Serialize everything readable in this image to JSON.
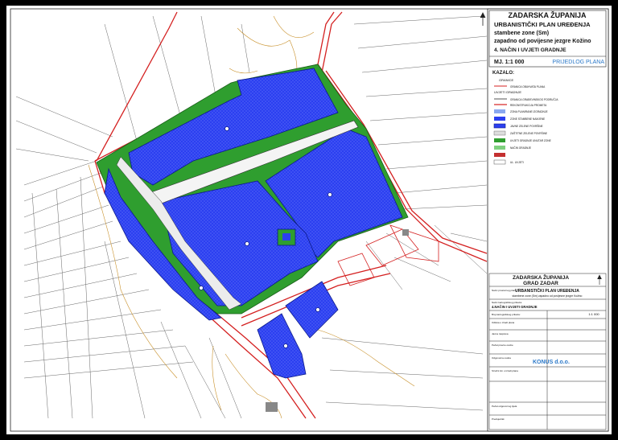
{
  "title_block": {
    "county": "ZADARSKA ŽUPANIJA",
    "plan_type": "URBANISTIČKI PLAN UREĐENJA",
    "line2": "stambene zone (Sm)",
    "line3": "zapadno od povijesne jezgre Kožino",
    "map_number": "4. NAČIN I UVJETI GRADNJE",
    "scale": "MJ. 1:1 000",
    "stage": "PRIJEDLOG PLANA"
  },
  "legend": {
    "heading": "KAZALO:",
    "section1": "GRANICE",
    "section2": "UVJETI GRADNJE",
    "items": [
      "GRANICA OBUHVATA PLANA",
      "GRANICA GRAĐEVINSKOG PODRUČJA",
      "REKONSTRUKCIJA PROMETA",
      "ZONA PLANIRANE IZGRADNJE",
      "ZONE STAMBENE NAMJENE",
      "JAVNE ZELENE POVRŠINE",
      "ZAŠTITNE ZELENE POVRŠINE",
      "UVJETI GRADNJE UNUTAR ZONE",
      "NAČIN GRADNJE",
      "UL. UVJETI"
    ]
  },
  "stamp": {
    "county": "ZADARSKA ŽUPANIJA",
    "city": "GRAD ZADAR",
    "plan_label": "Naziv prostornog plana:",
    "plan_name": "URBANISTIČKI PLAN UREĐENJA",
    "plan_sub": "stambene zone (Sm) zapadno od povijesne jezgre Kožino",
    "map_label": "Naziv kartografskog prikaza:",
    "map_name": "4.NAČIN I UVJETI GRADNJE",
    "scale": "1:1 000",
    "company": "KONUS d.o.o.",
    "rows": [
      "Broj kartografskog prikaza:",
      "Odluka o izradi plana",
      "Javna rasprava",
      "Pečat pravne osobe",
      "Odgovorna osoba",
      "Stručni tim u izradi plana",
      "Pečat odgovornog tijela",
      "Predsjednik"
    ]
  },
  "colors": {
    "zone_fill": "#2b3ff0",
    "green_buffer": "#2f9e2f",
    "road": "#d42020",
    "parcel": "#555555"
  }
}
